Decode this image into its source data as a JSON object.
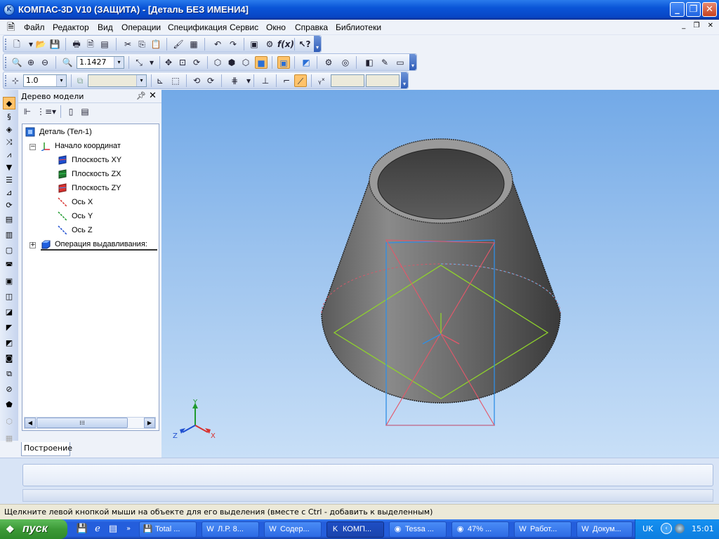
{
  "window": {
    "title": "КОМПАС-3D V10 (ЗАЩИТА) - [Деталь БЕЗ ИМЕНИ4]",
    "app_icon": "kompas-k-icon",
    "controls": [
      "minimize",
      "maximize",
      "close"
    ]
  },
  "menubar": {
    "items": [
      {
        "label": "Файл"
      },
      {
        "label": "Редактор"
      },
      {
        "label": "Вид"
      },
      {
        "label": "Операции"
      },
      {
        "label": "Спецификация"
      },
      {
        "label": "Сервис"
      },
      {
        "label": "Окно"
      },
      {
        "label": "Справка"
      },
      {
        "label": "Библиотеки"
      }
    ]
  },
  "toolbar_view": {
    "zoom_value": "1.1427"
  },
  "toolbar_props": {
    "step_value": "1.0"
  },
  "tree": {
    "title": "Дерево модели",
    "pin_icon": "pin-icon",
    "close_icon": "close-icon",
    "nodes": [
      {
        "label": "Деталь (Тел-1)",
        "icon": "part-icon",
        "level": 0,
        "expander": ""
      },
      {
        "label": "Начало координат",
        "icon": "origin-icon",
        "level": 1,
        "expander": "−"
      },
      {
        "label": "Плоскость XY",
        "icon": "plane-xy-icon",
        "level": 2,
        "expander": ""
      },
      {
        "label": "Плоскость ZX",
        "icon": "plane-zx-icon",
        "level": 2,
        "expander": ""
      },
      {
        "label": "Плоскость ZY",
        "icon": "plane-zy-icon",
        "level": 2,
        "expander": ""
      },
      {
        "label": "Ось X",
        "icon": "axis-x-icon",
        "level": 2,
        "expander": ""
      },
      {
        "label": "Ось Y",
        "icon": "axis-y-icon",
        "level": 2,
        "expander": ""
      },
      {
        "label": "Ось Z",
        "icon": "axis-z-icon",
        "level": 2,
        "expander": ""
      },
      {
        "label": "Операция выдавливания:",
        "icon": "extrude-icon",
        "level": 1,
        "expander": "+"
      }
    ],
    "tab_label": "Построение"
  },
  "viewport": {
    "axis_labels": {
      "x": "X",
      "y": "Y",
      "z": "Z"
    },
    "colors": {
      "plane_xy": "#8fd22c",
      "plane_zx": "#e4576a",
      "plane_zy": "#2f8fe6",
      "body": "#7d7d7d"
    }
  },
  "status": {
    "text": "Щелкните левой кнопкой мыши на объекте для его выделения (вместе с Ctrl - добавить к выделенным)"
  },
  "taskbar": {
    "start_label": "пуск",
    "tasks": [
      {
        "label": "Total ...",
        "icon": "total-commander-icon",
        "active": false
      },
      {
        "label": "Л.Р. 8...",
        "icon": "word-doc-icon",
        "active": false
      },
      {
        "label": "Содер...",
        "icon": "word-doc-icon",
        "active": false
      },
      {
        "label": "КОМП...",
        "icon": "kompas-k-icon",
        "active": true
      },
      {
        "label": "Tessa ...",
        "icon": "firefox-icon",
        "active": false
      },
      {
        "label": "47% ...",
        "icon": "firefox-icon",
        "active": false
      },
      {
        "label": "Работ...",
        "icon": "word-doc-icon",
        "active": false
      },
      {
        "label": "Докум...",
        "icon": "word-doc-icon",
        "active": false
      }
    ],
    "tray": {
      "language": "UK",
      "clock": "15:01"
    }
  }
}
